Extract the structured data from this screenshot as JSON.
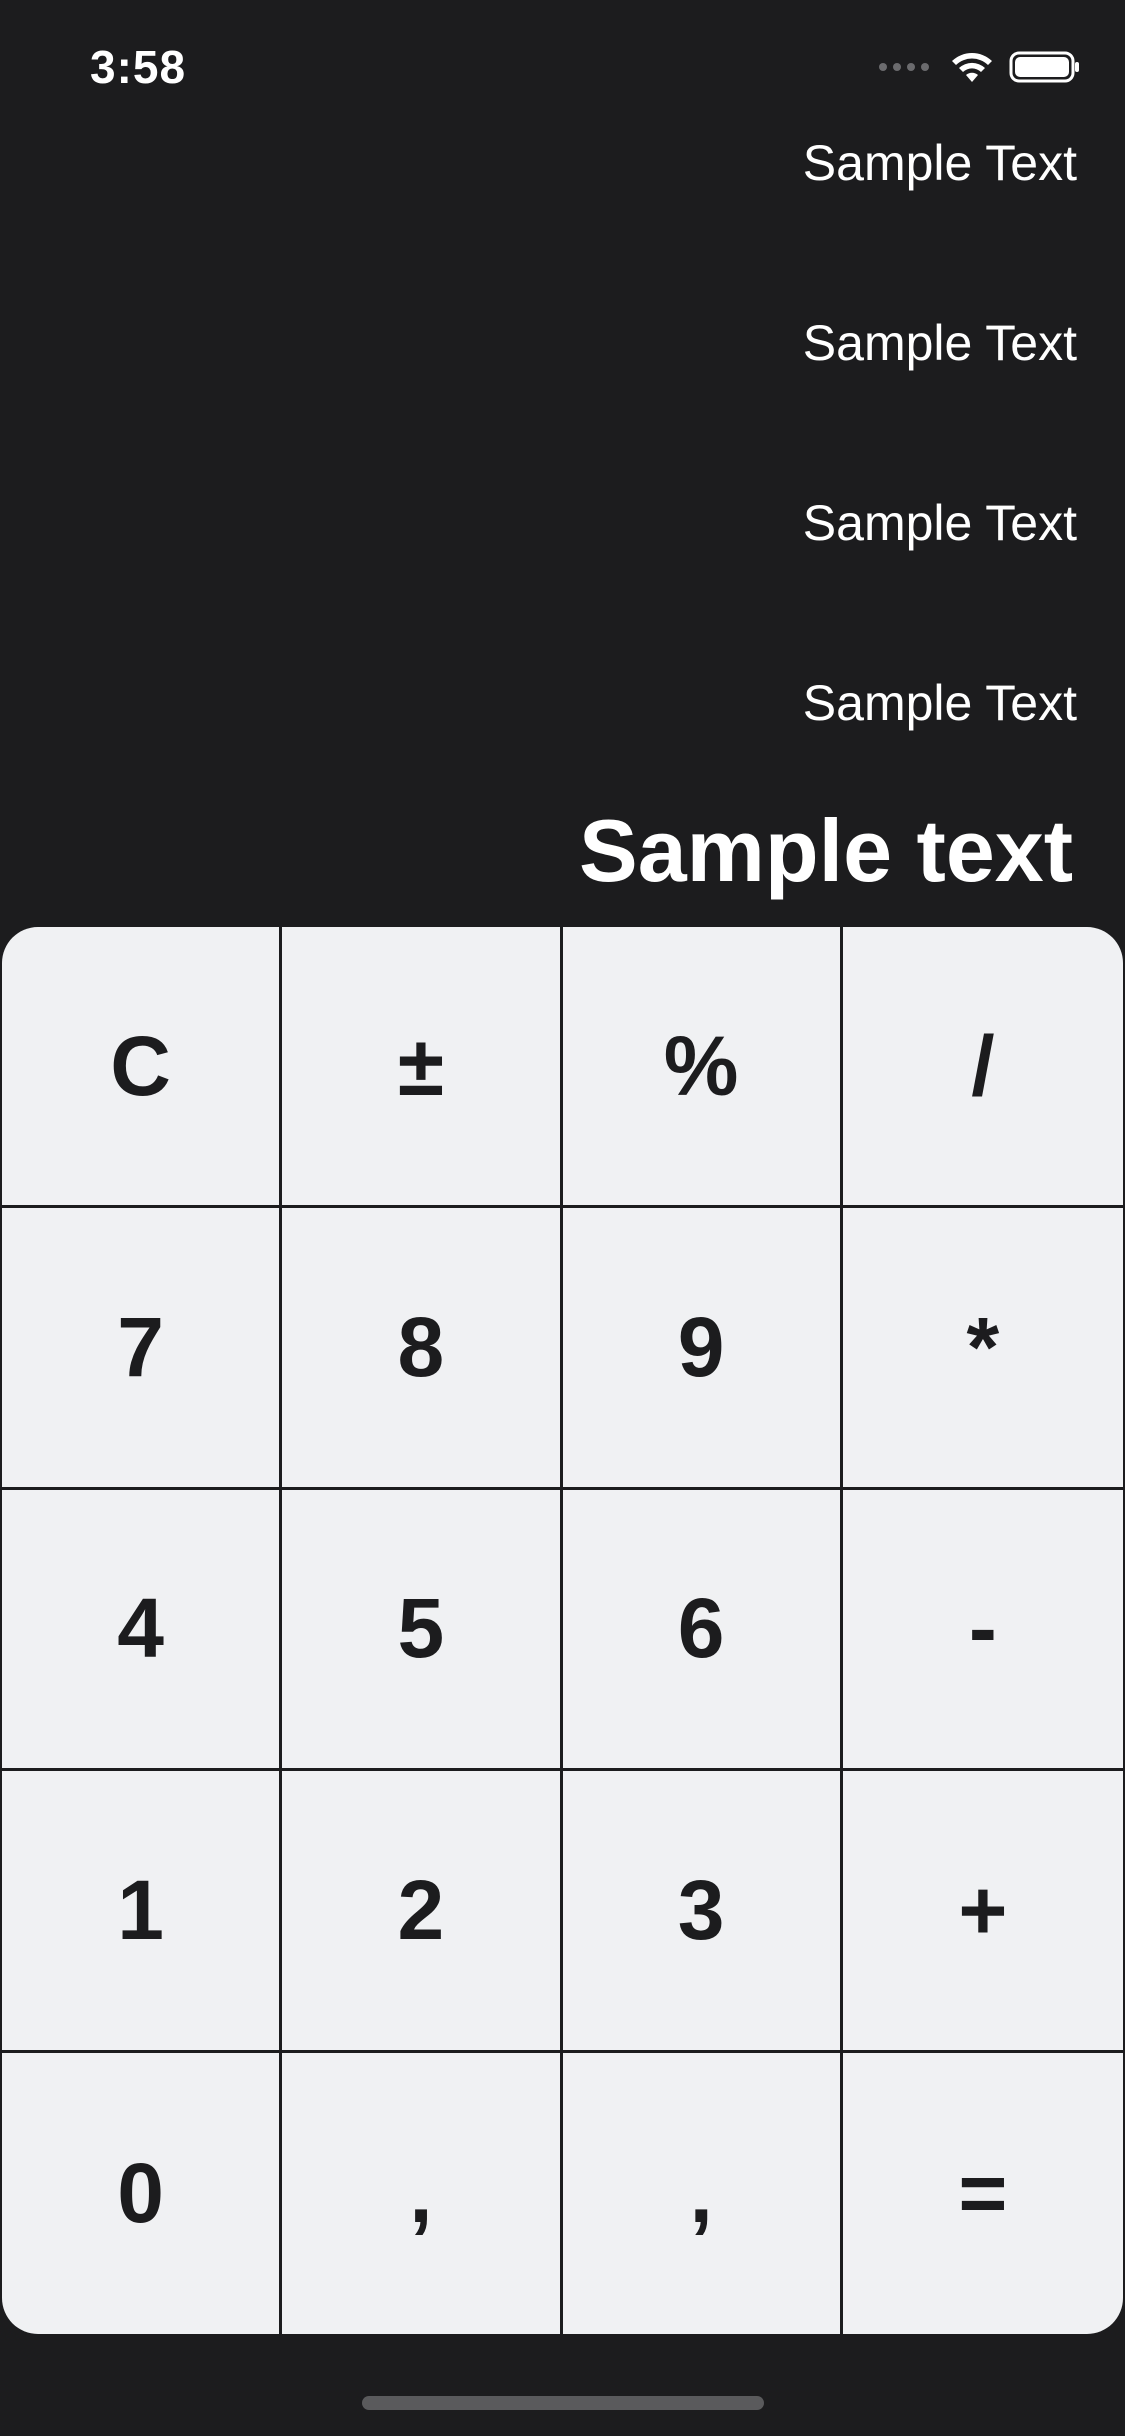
{
  "status_bar": {
    "time": "3:58"
  },
  "history": [
    "Sample Text",
    "Sample Text",
    "Sample Text",
    "Sample Text"
  ],
  "result": "Sample text",
  "keypad": {
    "keys": [
      {
        "label": "C",
        "name": "clear-button"
      },
      {
        "label": "±",
        "name": "plus-minus-button"
      },
      {
        "label": "%",
        "name": "percent-button"
      },
      {
        "label": "/",
        "name": "divide-button"
      },
      {
        "label": "7",
        "name": "digit-7-button"
      },
      {
        "label": "8",
        "name": "digit-8-button"
      },
      {
        "label": "9",
        "name": "digit-9-button"
      },
      {
        "label": "*",
        "name": "multiply-button"
      },
      {
        "label": "4",
        "name": "digit-4-button"
      },
      {
        "label": "5",
        "name": "digit-5-button"
      },
      {
        "label": "6",
        "name": "digit-6-button"
      },
      {
        "label": "-",
        "name": "subtract-button"
      },
      {
        "label": "1",
        "name": "digit-1-button"
      },
      {
        "label": "2",
        "name": "digit-2-button"
      },
      {
        "label": "3",
        "name": "digit-3-button"
      },
      {
        "label": "+",
        "name": "add-button"
      },
      {
        "label": "0",
        "name": "digit-0-button"
      },
      {
        "label": ",",
        "name": "comma-button"
      },
      {
        "label": ",",
        "name": "comma-button-2"
      },
      {
        "label": "=",
        "name": "equals-button"
      }
    ]
  },
  "icons": {
    "signal": "cellular-signal-icon",
    "wifi": "wifi-icon",
    "battery": "battery-icon"
  }
}
